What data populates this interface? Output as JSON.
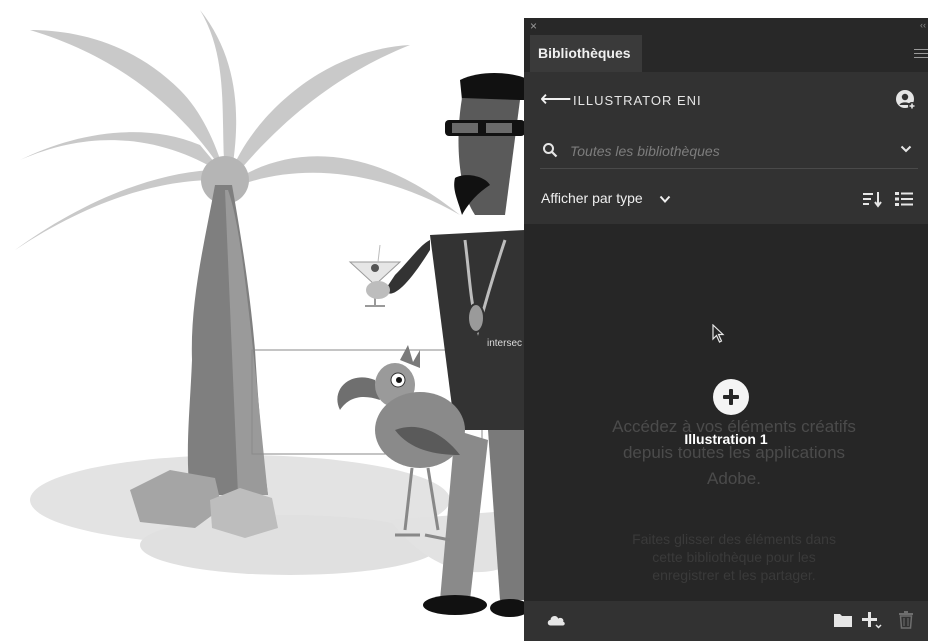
{
  "canvas": {
    "label": "intersec"
  },
  "panel": {
    "close_glyph": "×",
    "collapse_glyph": "‹‹",
    "tab_label": "Bibliothèques",
    "menu_icon": "hamburger-icon",
    "header": {
      "back_icon": "arrow-left-icon",
      "back_glyph": "⟵",
      "library_name": "ILLUSTRATOR ENI",
      "user_icon": "add-user-icon"
    },
    "search": {
      "icon": "search-icon",
      "placeholder": "Toutes les bibliothèques",
      "value": "",
      "dropdown_icon": "chevron-down-icon"
    },
    "view": {
      "label": "Afficher par type",
      "sort_icon": "sort-icon",
      "list_icon": "list-view-icon"
    },
    "content": {
      "add_label": "Illustration 1",
      "ghost_lines": [
        "Accédez à vos éléments créatifs",
        "depuis toutes les applications",
        "Adobe."
      ],
      "ghost_small": [
        "Faites glisser des éléments dans",
        "cette bibliothèque pour les",
        "enregistrer et les partager."
      ]
    },
    "footer": {
      "cloud_icon": "cloud-icon",
      "folder_icon": "folder-icon",
      "add_icon": "add-menu-icon",
      "trash_icon": "trash-icon"
    }
  },
  "colors": {
    "panel_bg": "#323232",
    "content_bg": "#262626",
    "text": "#e6e6e6"
  }
}
